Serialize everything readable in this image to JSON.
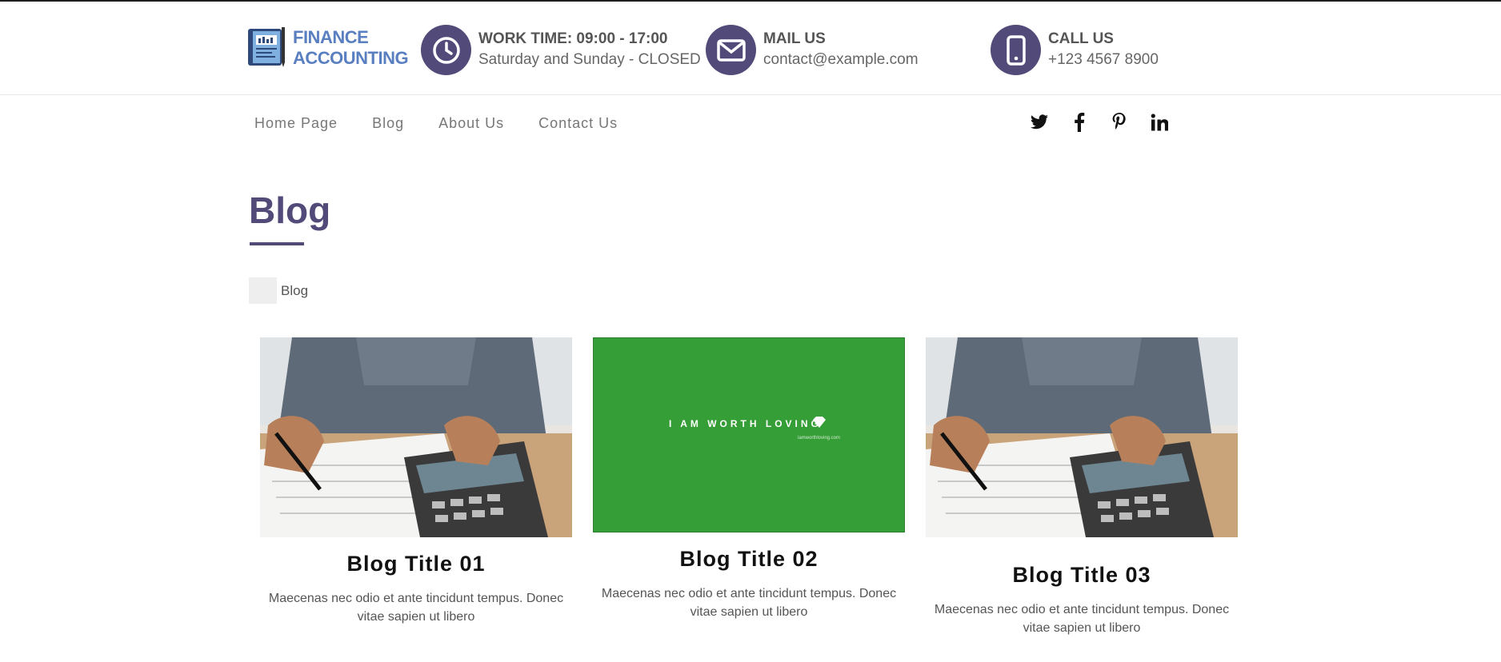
{
  "brand": {
    "line1": "FINANCE",
    "line2": "ACCOUNTING",
    "color": "#5a7fc0"
  },
  "header": {
    "work": {
      "title": "WORK TIME: 09:00 - 17:00",
      "sub": "Saturday and Sunday - CLOSED",
      "icon": "clock-icon"
    },
    "mail": {
      "title": "MAIL US",
      "sub": "contact@example.com",
      "icon": "envelope-icon"
    },
    "call": {
      "title": "CALL US",
      "sub": "+123 4567 8900",
      "icon": "phone-icon"
    },
    "accent": "#524b7a"
  },
  "nav": {
    "items": [
      "Home Page",
      "Blog",
      "About Us",
      "Contact Us"
    ]
  },
  "social": [
    "twitter-icon",
    "facebook-icon",
    "pinterest-icon",
    "linkedin-icon"
  ],
  "page": {
    "title": "Blog",
    "breadcrumb": "Blog"
  },
  "cards": [
    {
      "title": "Blog Title 01",
      "text": "Maecenas nec odio et ante tincidunt tempus. Donec vitae sapien ut libero",
      "image": "calculator-photo"
    },
    {
      "title": "Blog Title 02",
      "text": "Maecenas nec odio et ante tincidunt tempus. Donec vitae sapien ut libero",
      "image": "green-banner",
      "image_text": "I AM WORTH LOVING",
      "image_subtext": "iamworthloving.com"
    },
    {
      "title": "Blog Title 03",
      "text": "Maecenas nec odio et ante tincidunt tempus. Donec vitae sapien ut libero",
      "image": "calculator-photo"
    }
  ]
}
